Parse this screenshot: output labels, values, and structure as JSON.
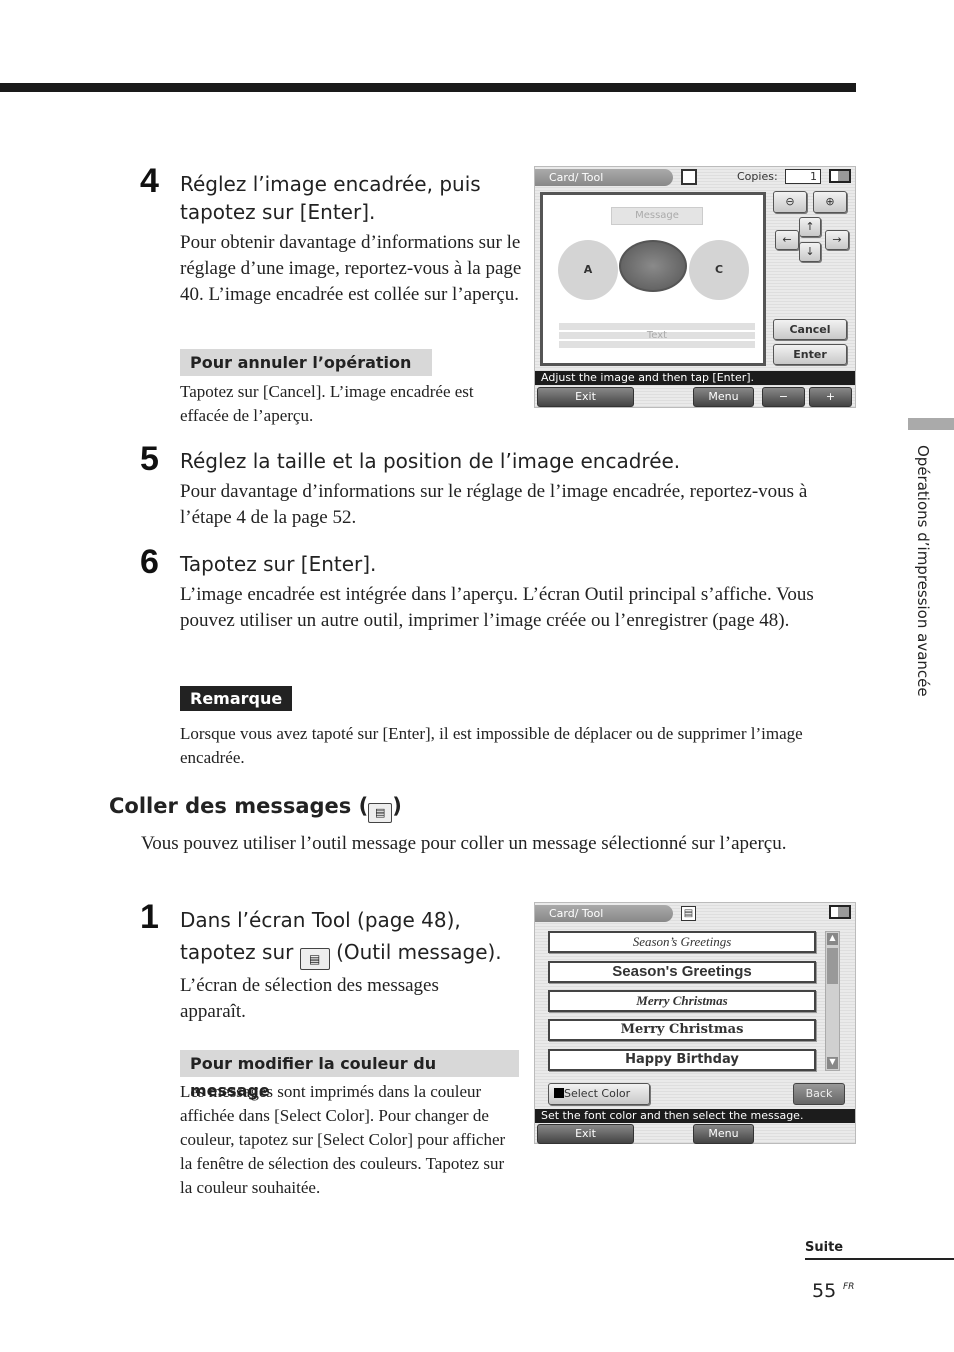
{
  "step4": {
    "num": "4",
    "title": "Réglez l’image encadrée, puis tapotez sur [Enter].",
    "body": "Pour obtenir davantage d’informations sur le réglage d’une image, reportez-vous à la page 40. L’image encadrée est collée sur l’aperçu.",
    "band": "Pour annuler l’opération",
    "band_body": "Tapotez sur [Cancel]. L’image encadrée est effacée de l’aperçu."
  },
  "screen1": {
    "title": "Card/ Tool",
    "copies_label": "Copies:",
    "copies_value": "1",
    "message": "Message",
    "circle_a": "A",
    "circle_c": "C",
    "text": "Text",
    "cancel": "Cancel",
    "enter": "Enter",
    "status": "Adjust the image and then tap [Enter].",
    "exit": "Exit",
    "menu": "Menu",
    "minus": "−",
    "plus": "+"
  },
  "step5": {
    "num": "5",
    "title": "Réglez la taille et la position de l’image encadrée.",
    "body": "Pour davantage d’informations sur le réglage de l’image encadrée, reportez-vous à l’étape 4 de la page 52."
  },
  "step6": {
    "num": "6",
    "title": "Tapotez sur [Enter].",
    "body": "L’image encadrée est intégrée dans l’aperçu. L’écran Outil principal s’affiche. Vous pouvez utiliser un autre outil, imprimer l’image créée ou l’enregistrer (page 48).",
    "remark_label": "Remarque",
    "remark": "Lorsque vous avez tapoté sur [Enter], il est impossible de déplacer ou de supprimer l’image encadrée."
  },
  "section": {
    "title_pre": "Coller des messages (",
    "title_post": ")",
    "intro": "Vous pouvez utiliser l’outil message pour coller un message sélectionné sur l’aperçu."
  },
  "step1": {
    "num": "1",
    "title_a": "Dans l’écran Tool (page 48),",
    "title_b": "tapotez sur",
    "title_c": "(Outil message).",
    "body": "L’écran de sélection des messages apparaît.",
    "band": "Pour modifier la couleur du message",
    "band_body": "Les messages sont imprimés dans la couleur affichée dans [Select Color]. Pour changer de couleur, tapotez sur [Select Color] pour afficher la fenêtre de sélection des couleurs. Tapotez sur la couleur souhaitée."
  },
  "screen2": {
    "title": "Card/ Tool",
    "messages": [
      "Season’s Greetings",
      "Season's Greetings",
      "Merry Christmas",
      "Merry Christmas",
      "Happy Birthday"
    ],
    "select_color": "Select Color",
    "back": "Back",
    "status": "Set the font color and then select the message.",
    "exit": "Exit",
    "menu": "Menu"
  },
  "sidebar": {
    "text": "Opérations d’impression avancée"
  },
  "footer": {
    "suite": "Suite",
    "page": "55",
    "lang": "FR"
  }
}
